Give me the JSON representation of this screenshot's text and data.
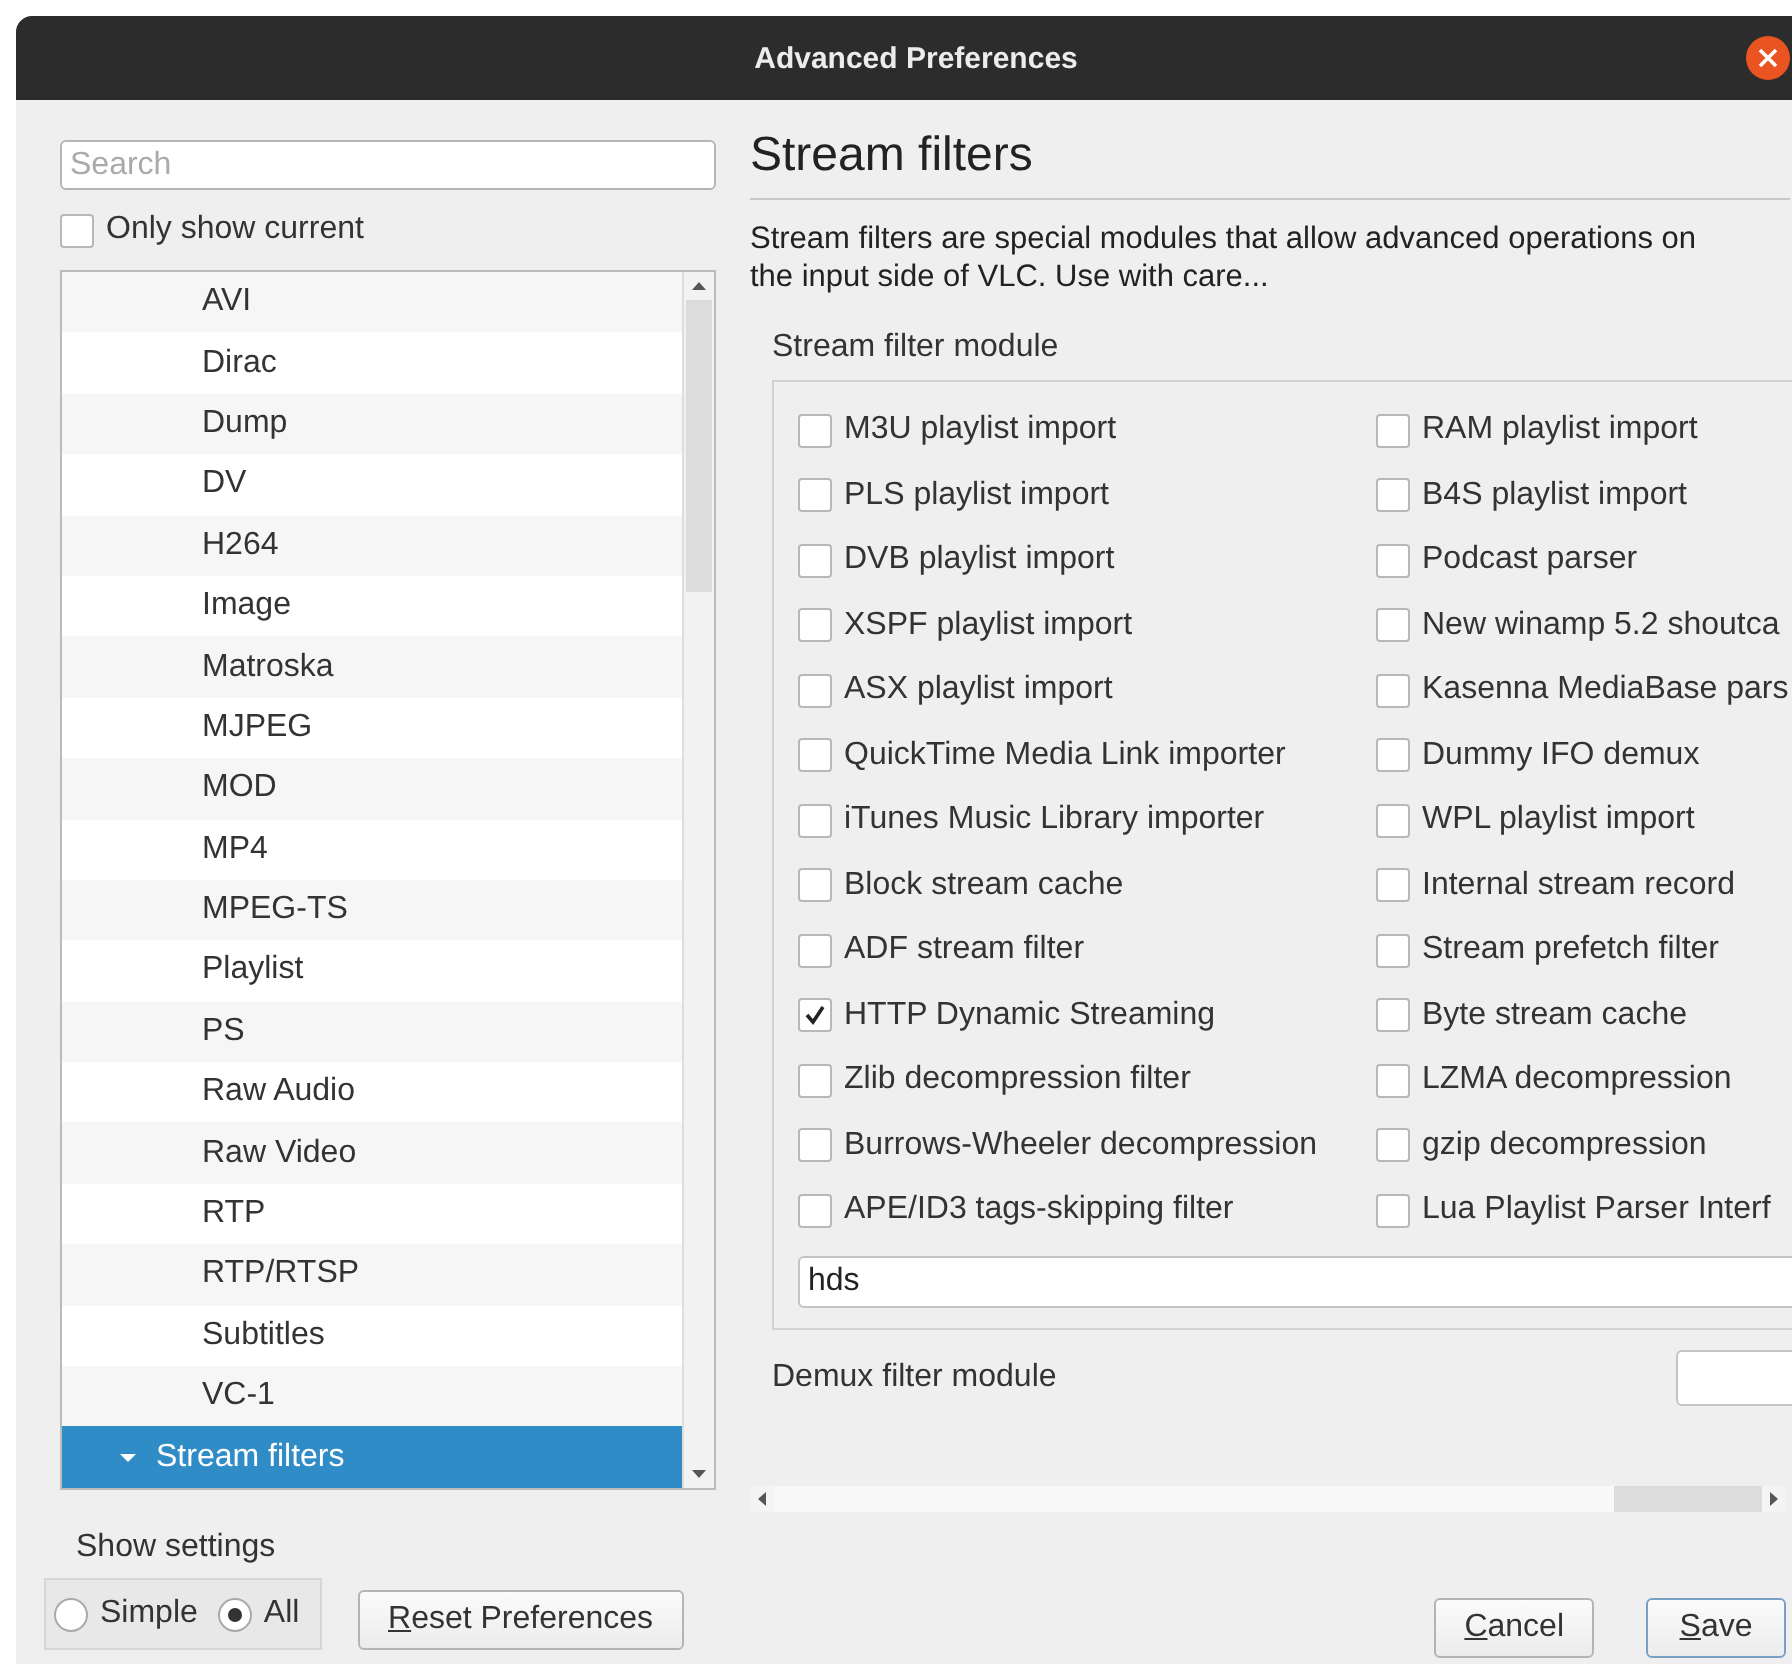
{
  "window": {
    "title": "Advanced Preferences"
  },
  "search": {
    "placeholder": "Search"
  },
  "only_show_current": {
    "label": "Only show current",
    "checked": false
  },
  "tree": {
    "items": [
      {
        "label": "AVI",
        "kind": "module",
        "selected": false
      },
      {
        "label": "Dirac",
        "kind": "module",
        "selected": false
      },
      {
        "label": "Dump",
        "kind": "module",
        "selected": false
      },
      {
        "label": "DV",
        "kind": "module",
        "selected": false
      },
      {
        "label": "H264",
        "kind": "module",
        "selected": false
      },
      {
        "label": "Image",
        "kind": "module",
        "selected": false
      },
      {
        "label": "Matroska",
        "kind": "module",
        "selected": false
      },
      {
        "label": "MJPEG",
        "kind": "module",
        "selected": false
      },
      {
        "label": "MOD",
        "kind": "module",
        "selected": false
      },
      {
        "label": "MP4",
        "kind": "module",
        "selected": false
      },
      {
        "label": "MPEG-TS",
        "kind": "module",
        "selected": false
      },
      {
        "label": "Playlist",
        "kind": "module",
        "selected": false
      },
      {
        "label": "PS",
        "kind": "module",
        "selected": false
      },
      {
        "label": "Raw Audio",
        "kind": "module",
        "selected": false
      },
      {
        "label": "Raw Video",
        "kind": "module",
        "selected": false
      },
      {
        "label": "RTP",
        "kind": "module",
        "selected": false
      },
      {
        "label": "RTP/RTSP",
        "kind": "module",
        "selected": false
      },
      {
        "label": "Subtitles",
        "kind": "module",
        "selected": false
      },
      {
        "label": "VC-1",
        "kind": "module",
        "selected": false
      },
      {
        "label": "Stream filters",
        "kind": "category",
        "expanded": true,
        "selected": true
      }
    ]
  },
  "show_settings": {
    "label": "Show settings",
    "options": [
      {
        "label": "Simple",
        "selected": false
      },
      {
        "label": "All",
        "selected": true
      }
    ]
  },
  "reset_button": "Reset Preferences",
  "panel": {
    "title": "Stream filters",
    "description": "Stream filters are special modules that allow advanced operations on the input side of VLC. Use with care...",
    "stream_filter_module": {
      "label": "Stream filter module",
      "value": "hds",
      "options": [
        {
          "label": "M3U playlist import",
          "checked": false
        },
        {
          "label": "RAM playlist import",
          "checked": false
        },
        {
          "label": "PLS playlist import",
          "checked": false
        },
        {
          "label": "B4S playlist import",
          "checked": false
        },
        {
          "label": "DVB playlist import",
          "checked": false
        },
        {
          "label": "Podcast parser",
          "checked": false
        },
        {
          "label": "XSPF playlist import",
          "checked": false
        },
        {
          "label": "New winamp 5.2 shoutca",
          "checked": false
        },
        {
          "label": "ASX playlist import",
          "checked": false
        },
        {
          "label": "Kasenna MediaBase pars",
          "checked": false
        },
        {
          "label": "QuickTime Media Link importer",
          "checked": false
        },
        {
          "label": "Dummy IFO demux",
          "checked": false
        },
        {
          "label": "iTunes Music Library importer",
          "checked": false
        },
        {
          "label": "WPL playlist import",
          "checked": false
        },
        {
          "label": "Block stream cache",
          "checked": false
        },
        {
          "label": "Internal stream record",
          "checked": false
        },
        {
          "label": "ADF stream filter",
          "checked": false
        },
        {
          "label": "Stream prefetch filter",
          "checked": false
        },
        {
          "label": "HTTP Dynamic Streaming",
          "checked": true
        },
        {
          "label": "Byte stream cache",
          "checked": false
        },
        {
          "label": "Zlib decompression filter",
          "checked": false
        },
        {
          "label": "LZMA decompression",
          "checked": false
        },
        {
          "label": "Burrows-Wheeler decompression",
          "checked": false
        },
        {
          "label": "gzip decompression",
          "checked": false
        },
        {
          "label": "APE/ID3 tags-skipping filter",
          "checked": false
        },
        {
          "label": "Lua Playlist Parser Interf",
          "checked": false
        }
      ]
    },
    "demux_filter_module": {
      "label": "Demux filter module"
    }
  },
  "buttons": [
    {
      "label": "Cancel",
      "default": false
    },
    {
      "label": "Save",
      "default": true
    }
  ]
}
